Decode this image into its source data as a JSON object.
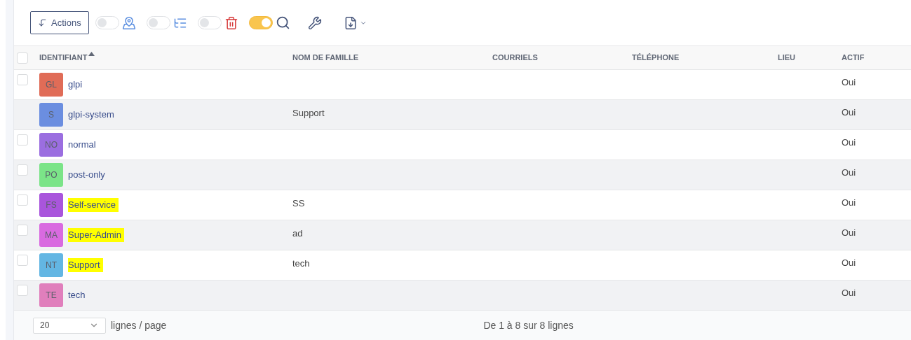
{
  "toolbar": {
    "actions_button": "Actions",
    "toggles": [
      {
        "on": false
      },
      {
        "on": false
      },
      {
        "on": false
      },
      {
        "on": true
      }
    ]
  },
  "table": {
    "all_checked": false,
    "columns": [
      {
        "label": "IDENTIFIANT",
        "sorted": true
      },
      {
        "label": "NOM DE FAMILLE",
        "sorted": false
      },
      {
        "label": "COURRIELS",
        "sorted": false
      },
      {
        "label": "TÉLÉPHONE",
        "sorted": false
      },
      {
        "label": "LIEU",
        "sorted": false
      },
      {
        "label": "ACTIF",
        "sorted": false
      }
    ],
    "rows": [
      {
        "checked": false,
        "initials": "GL",
        "color": "#e06c57",
        "login": "glpi",
        "highlighted": false,
        "active": "Oui"
      },
      {
        "initials": "S",
        "color": "#6b8ee0",
        "login": "glpi-system",
        "highlighted": false,
        "last_name": "Support",
        "active": "Oui"
      },
      {
        "checked": false,
        "initials": "NO",
        "color": "#9b6ee0",
        "login": "normal",
        "highlighted": false,
        "active": "Oui"
      },
      {
        "checked": false,
        "initials": "PO",
        "color": "#7be488",
        "login": "post-only",
        "highlighted": false,
        "active": "Oui"
      },
      {
        "checked": false,
        "initials": "FS",
        "color": "#a955dc",
        "login": "Self-service",
        "highlighted": true,
        "last_name": "SS",
        "active": "Oui"
      },
      {
        "checked": false,
        "initials": "MA",
        "color": "#d96ae0",
        "login": "Super-Admin",
        "highlighted": true,
        "last_name": "ad",
        "active": "Oui"
      },
      {
        "checked": false,
        "initials": "NT",
        "color": "#63b6e3",
        "login": "Support",
        "highlighted": true,
        "last_name": "tech",
        "active": "Oui"
      },
      {
        "checked": false,
        "initials": "TE",
        "color": "#e07fbc",
        "login": "tech",
        "highlighted": false,
        "active": "Oui"
      }
    ]
  },
  "pagination": {
    "page_size": "20",
    "page_size_label": "lignes / page",
    "summary": "De 1 à 8 sur 8 lignes"
  }
}
